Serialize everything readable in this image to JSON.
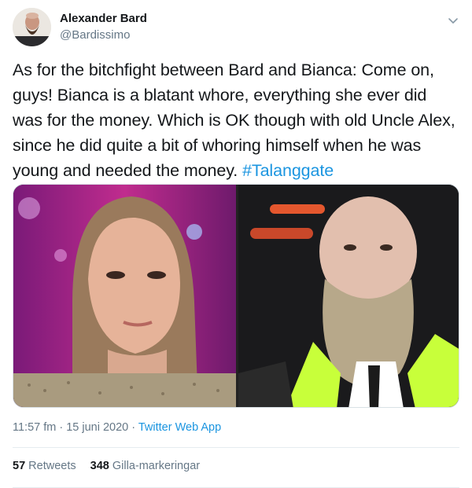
{
  "author": {
    "name": "Alexander Bard",
    "handle": "@Bardissimo",
    "avatar_icon": "person-avatar"
  },
  "tweet": {
    "text": "As for the bitchfight between Bard and Bianca: Come on, guys! Bianca is a blatant whore, everything she ever did was for the money. Which is OK though with old Uncle Alex, since he did quite a bit of whoring himself when he was young and needed the money. ",
    "hashtag": "#Talanggate"
  },
  "media": {
    "left_photo": "woman-portrait-photo",
    "right_photo": "bearded-man-portrait-photo"
  },
  "meta": {
    "timestamp": "11:57 fm · 15 juni 2020 · ",
    "source": "Twitter Web App"
  },
  "stats": {
    "retweets_count": "57",
    "retweets_label": "Retweets",
    "likes_count": "348",
    "likes_label": "Gilla-markeringar"
  },
  "colors": {
    "link": "#1b95e0",
    "secondary_text": "#657786",
    "primary_text": "#14171a"
  }
}
